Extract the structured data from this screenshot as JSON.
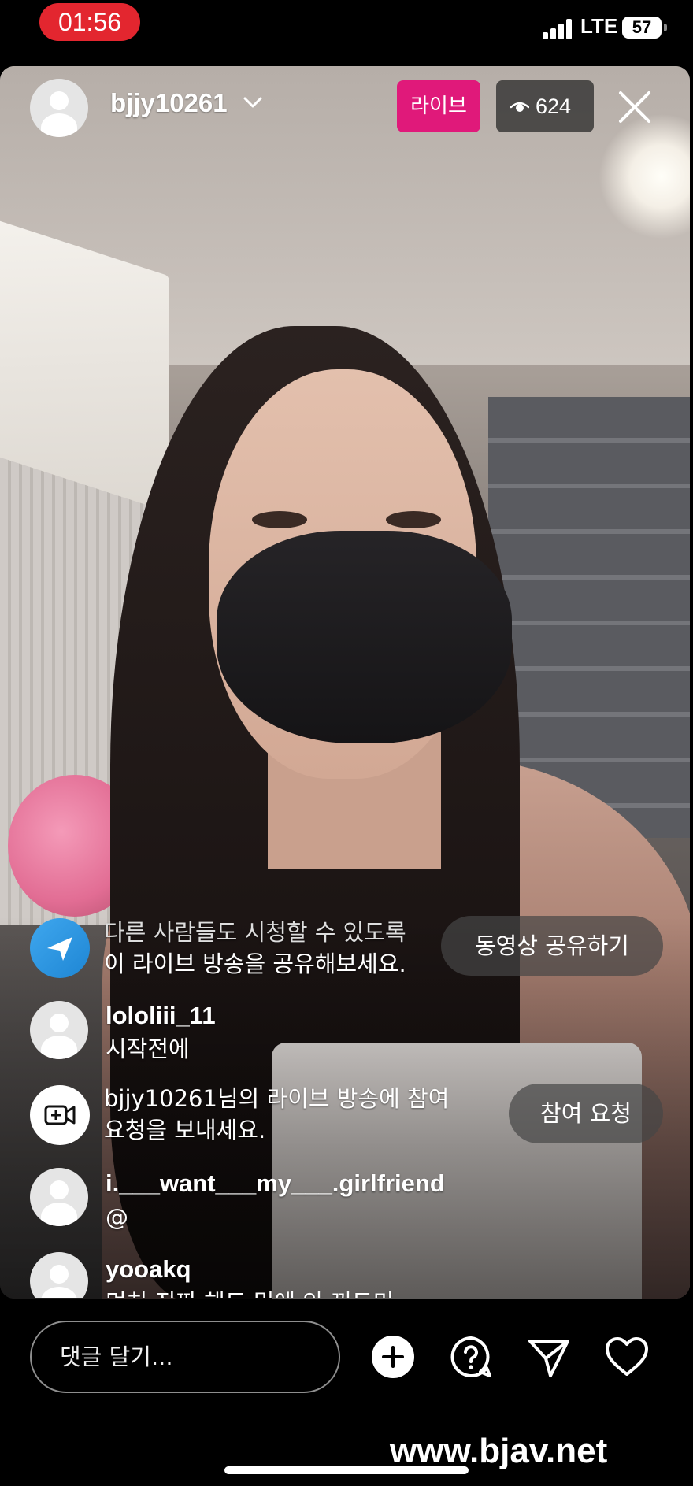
{
  "status_bar": {
    "time": "01:56",
    "network": "LTE",
    "battery": "57",
    "icons": [
      "signal-icon",
      "battery-icon"
    ]
  },
  "header": {
    "host_username": "bjjy10261",
    "live_label": "라이브",
    "viewer_count": "624",
    "icons": [
      "avatar-icon",
      "chevron-down-icon",
      "eye-icon",
      "close-icon"
    ]
  },
  "feed": {
    "share_prompt": {
      "line1": "다른 사람들도 시청할 수 있도록",
      "line2": "이 라이브 방송을 공유해보세요.",
      "button": "동영상 공유하기"
    },
    "comments": [
      {
        "username": "lololiii_11",
        "text": "시작전에"
      },
      {
        "username": "i.___want___my___.girlfriend",
        "text": "@"
      },
      {
        "username": "yooakq",
        "text": "멋치 진짜 해도 밑에 안 꺼도미"
      }
    ],
    "join_prompt": {
      "line1": "bjjy10261님의 라이브 방송에 참여",
      "line2": "요청을 보내세요.",
      "button": "참여 요청"
    }
  },
  "bottom_bar": {
    "comment_placeholder": "댓글 달기...",
    "icons": [
      "add-icon",
      "question-icon",
      "send-icon",
      "heart-icon"
    ]
  },
  "watermark": "www.bjav.net",
  "colors": {
    "time_pill": "#e3262f",
    "live_badge": "#e0197a",
    "share_icon": "#2b95e2"
  }
}
